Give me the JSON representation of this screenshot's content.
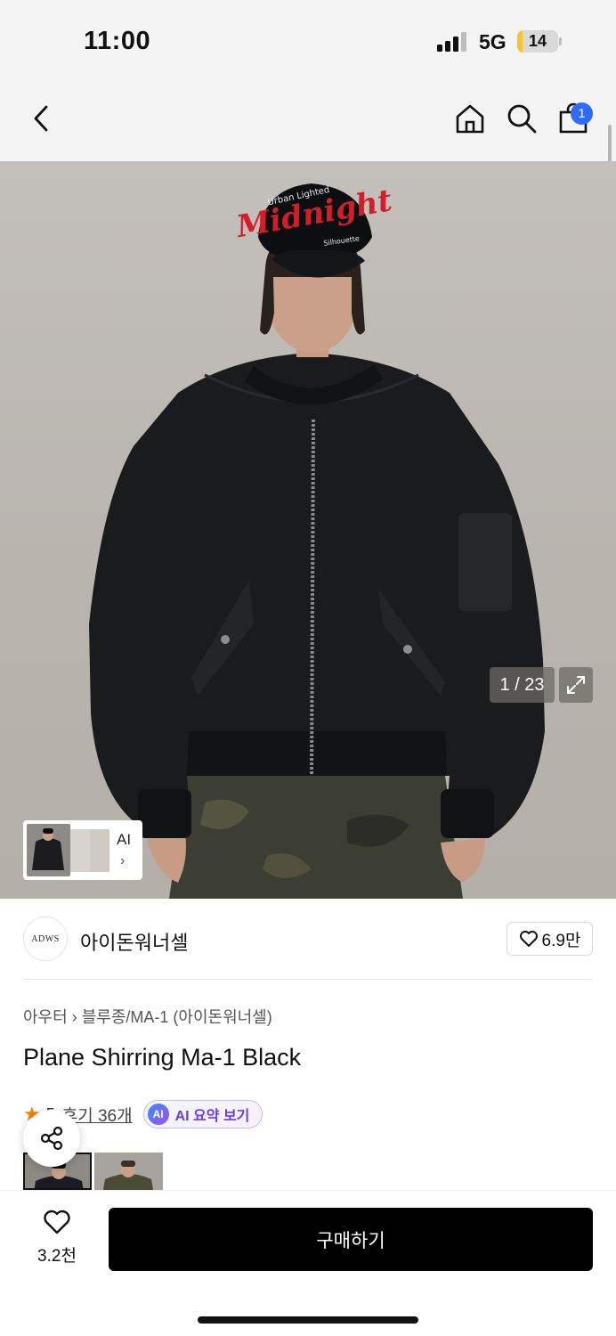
{
  "status_bar": {
    "time": "11:00",
    "network": "5G",
    "battery": "14",
    "battery_level": 0.14
  },
  "nav": {
    "cart_count": "1",
    "icons": [
      "back-chevron-icon",
      "home-icon",
      "search-icon",
      "shopping-bag-icon"
    ]
  },
  "hero": {
    "image_counter": "1 / 23",
    "thumb_card_label": "AI",
    "cap_text": "Midnight",
    "cap_top_text": "Urban Lighted",
    "cap_side_text": "Silhouette"
  },
  "brand": {
    "logo_text": "ADWS",
    "name": "아이돈워너셀",
    "likes": "6.9만"
  },
  "product": {
    "breadcrumb_category": "아우터",
    "breadcrumb_sub": "블루종/MA-1 (아이돈워너셀)",
    "title": "Plane Shirring Ma-1 Black",
    "rating": "5",
    "reviews": "후기 36개",
    "ai_summary": "AI 요약 보기",
    "ai_badge": "AI"
  },
  "bottom": {
    "wish_count": "3.2천",
    "buy_label": "구매하기"
  },
  "colors": {
    "accent_blue": "#2f6bff",
    "star_orange": "#ff7a00",
    "ai_purple": "#6a3cf0",
    "buy_bg": "#000000"
  }
}
